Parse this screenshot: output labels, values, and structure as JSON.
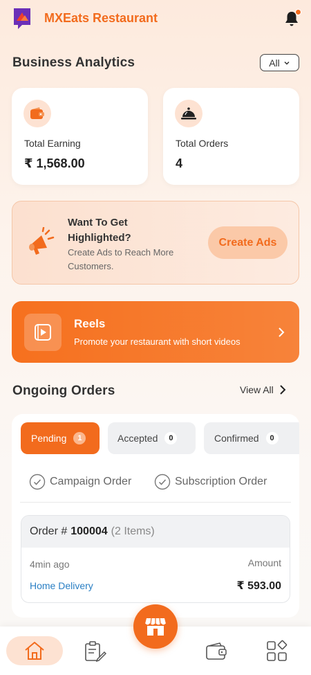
{
  "header": {
    "app_title": "MXEats Restaurant"
  },
  "analytics": {
    "title": "Business Analytics",
    "filter_value": "All",
    "cards": [
      {
        "label": "Total Earning",
        "value": "₹ 1,568.00"
      },
      {
        "label": "Total Orders",
        "value": "4"
      }
    ]
  },
  "ads": {
    "title": "Want To Get Highlighted?",
    "subtitle": "Create Ads to Reach More Customers.",
    "button_label": "Create Ads"
  },
  "reels": {
    "title": "Reels",
    "subtitle": "Promote your restaurant with short videos"
  },
  "ongoing": {
    "title": "Ongoing Orders",
    "view_all": "View All",
    "tabs": [
      {
        "label": "Pending",
        "count": "1"
      },
      {
        "label": "Accepted",
        "count": "0"
      },
      {
        "label": "Confirmed",
        "count": "0"
      }
    ],
    "checks": [
      "Campaign Order",
      "Subscription Order"
    ],
    "order": {
      "prefix": "Order #",
      "number": "100004",
      "items": "(2 Items)",
      "time": "4min ago",
      "amount_label": "Amount",
      "type": "Home Delivery",
      "amount": "₹ 593.00"
    }
  },
  "colors": {
    "accent": "#f26b1d",
    "link": "#2a7fc4"
  }
}
